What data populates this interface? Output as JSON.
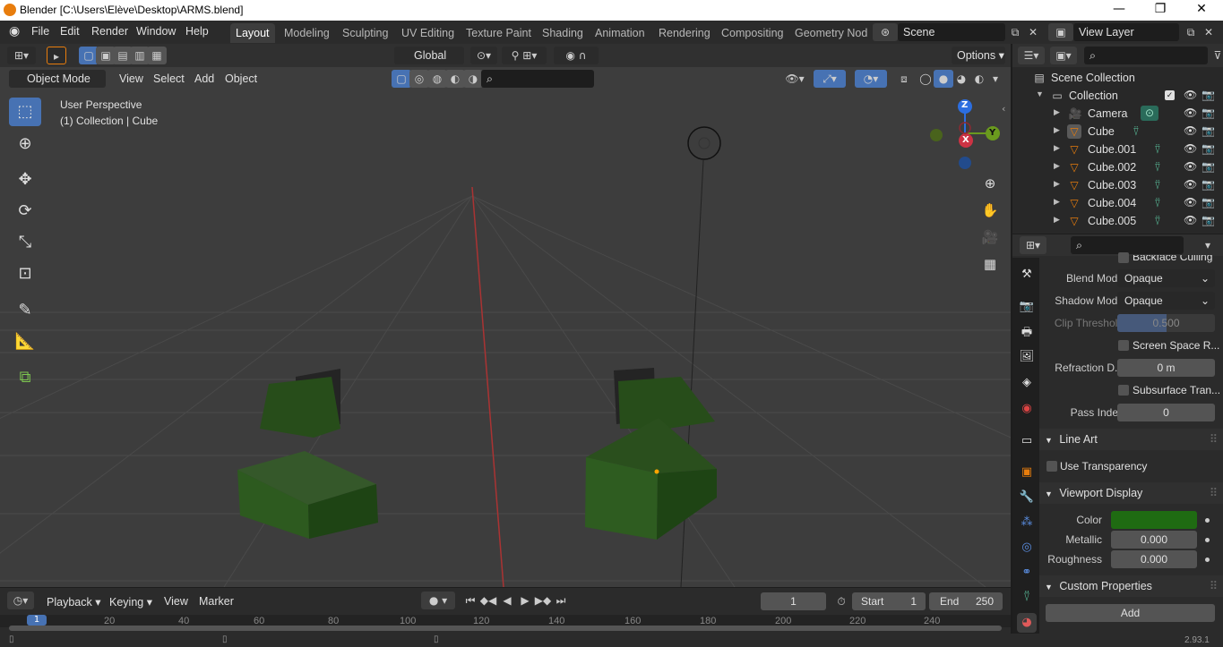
{
  "window": {
    "title": "Blender [C:\\Users\\Elève\\Desktop\\ARMS.blend]",
    "minimize": "—",
    "maximize": "❐",
    "close": "✕"
  },
  "menu": [
    "File",
    "Edit",
    "Render",
    "Window",
    "Help"
  ],
  "workspaces": {
    "active": "Layout",
    "tabs": [
      "Layout",
      "Modeling",
      "Sculpting",
      "UV Editing",
      "Texture Paint",
      "Shading",
      "Animation",
      "Rendering",
      "Compositing",
      "Geometry Nod"
    ]
  },
  "scene": {
    "name": "Scene",
    "view_layer": "View Layer"
  },
  "tool_header": {
    "orientation": "Global",
    "options": "Options"
  },
  "viewport_header": {
    "mode": "Object Mode",
    "menus": [
      "View",
      "Select",
      "Add",
      "Object"
    ]
  },
  "viewport": {
    "perspective": "User Perspective",
    "context": "(1) Collection | Cube",
    "gizmo": {
      "z": "Z",
      "x": "X",
      "y": "Y"
    },
    "cube_color": "#2d5a1f"
  },
  "timeline": {
    "menus": [
      "Playback",
      "Keying",
      "View",
      "Marker"
    ],
    "current_frame": "1",
    "start_label": "Start",
    "start": "1",
    "end_label": "End",
    "end": "250",
    "ticks": [
      "1",
      "20",
      "40",
      "60",
      "80",
      "100",
      "120",
      "140",
      "160",
      "180",
      "200",
      "220",
      "240"
    ]
  },
  "outliner": {
    "scene_collection": "Scene Collection",
    "collection": "Collection",
    "items": [
      {
        "name": "Camera",
        "icon": "camera-icon"
      },
      {
        "name": "Cube",
        "icon": "mesh-icon"
      },
      {
        "name": "Cube.001",
        "icon": "mesh-icon"
      },
      {
        "name": "Cube.002",
        "icon": "mesh-icon"
      },
      {
        "name": "Cube.003",
        "icon": "mesh-icon"
      },
      {
        "name": "Cube.004",
        "icon": "mesh-icon"
      },
      {
        "name": "Cube.005",
        "icon": "mesh-icon"
      }
    ]
  },
  "properties": {
    "backface_culling": "Backface Culling",
    "blend_mode_label": "Blend Mode",
    "blend_mode": "Opaque",
    "shadow_mode_label": "Shadow Mode",
    "shadow_mode": "Opaque",
    "clip_threshold_label": "Clip Threshold",
    "clip_threshold": "0.500",
    "screen_space": "Screen Space R...",
    "refraction_label": "Refraction D...",
    "refraction": "0 m",
    "subsurface": "Subsurface Tran...",
    "pass_index_label": "Pass Index",
    "pass_index": "0",
    "line_art": "Line Art",
    "use_transparency": "Use Transparency",
    "viewport_display": "Viewport Display",
    "color_label": "Color",
    "color": "#1f6b12",
    "metallic_label": "Metallic",
    "metallic": "0.000",
    "roughness_label": "Roughness",
    "roughness": "0.000",
    "custom_properties": "Custom Properties",
    "add": "Add"
  },
  "status": {
    "version": "2.93.1"
  }
}
